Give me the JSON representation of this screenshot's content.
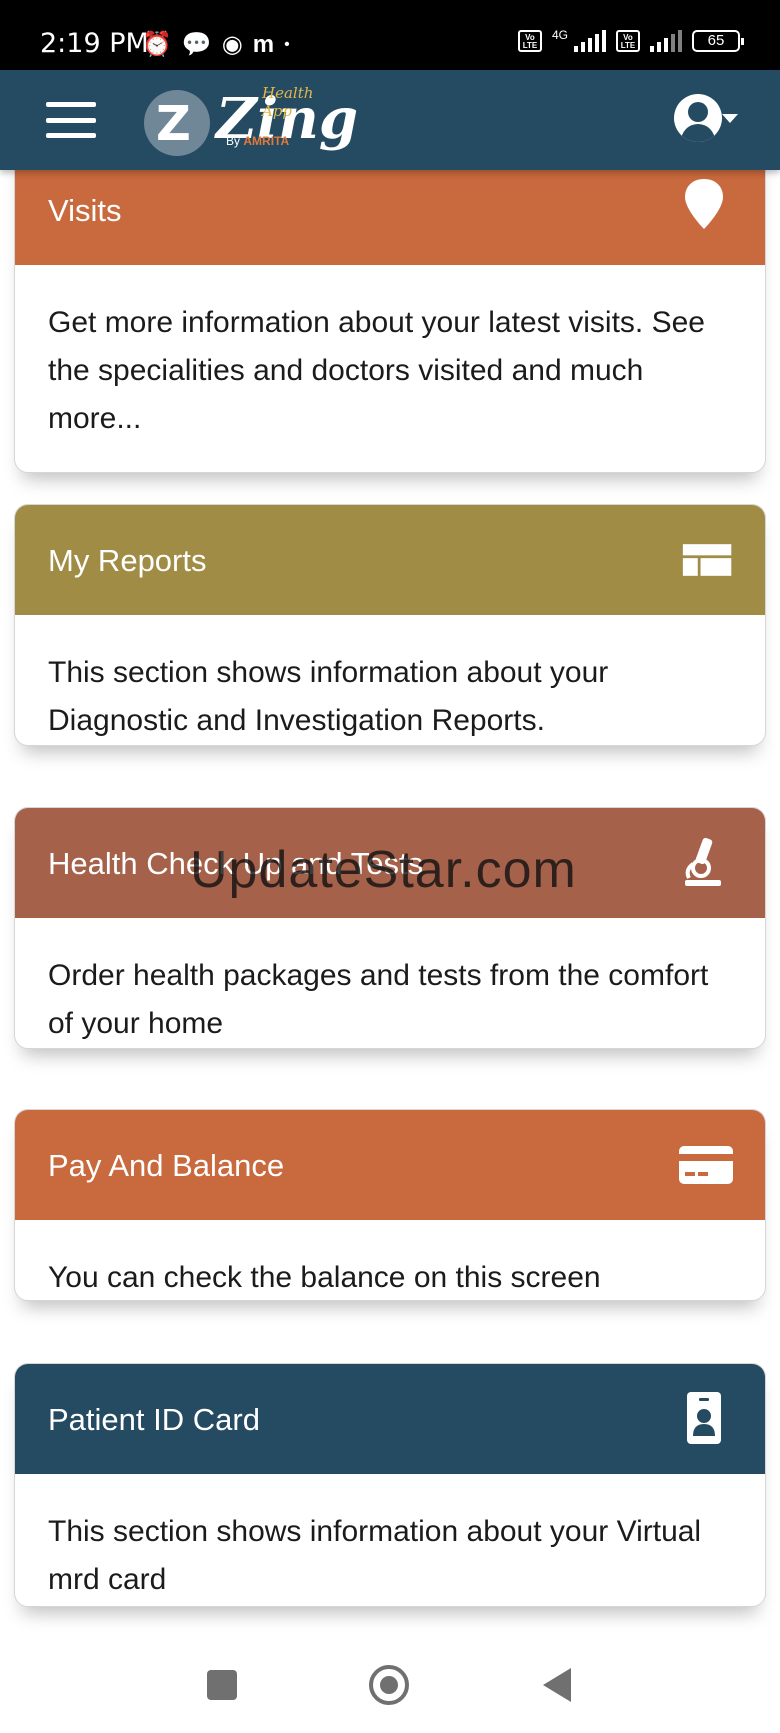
{
  "status_bar": {
    "time": "2:19 PM",
    "notification_icons": [
      "alarm-icon",
      "chat-bubble-icon",
      "chrome-icon",
      "m-app-icon"
    ],
    "dot": "•",
    "volte_label": "Vo LTE",
    "network": "4G",
    "battery": "65"
  },
  "header": {
    "logo": {
      "mark": "Z",
      "name": "Zing",
      "tagline": "Health App",
      "by": "By",
      "brand": "AMRITA"
    },
    "menu_icon": "hamburger-icon",
    "account_icon": "account-circle-icon"
  },
  "cards": [
    {
      "title": "Visits",
      "icon": "map-pin-icon",
      "color": "#c8693e",
      "description": "Get more information about your latest visits. See the specialities and doctors visited and much more..."
    },
    {
      "title": "My Reports",
      "icon": "dashboard-layout-icon",
      "color": "#a08c45",
      "description": "This section shows information about your Diagnostic and Investigation Reports."
    },
    {
      "title": "Health Check Up and Tests",
      "icon": "microscope-icon",
      "color": "#a5614a",
      "description": "Order health packages and tests from the comfort of your home"
    },
    {
      "title": "Pay And Balance",
      "icon": "credit-card-icon",
      "color": "#c8693e",
      "description": "You can check the balance on this screen"
    },
    {
      "title": "Patient ID Card",
      "icon": "id-badge-icon",
      "color": "#254b62",
      "description": "This section shows information about your Virtual mrd card"
    }
  ],
  "watermark": "UpdateStar.com",
  "nav_bar": [
    "recents-button",
    "home-button",
    "back-button"
  ]
}
